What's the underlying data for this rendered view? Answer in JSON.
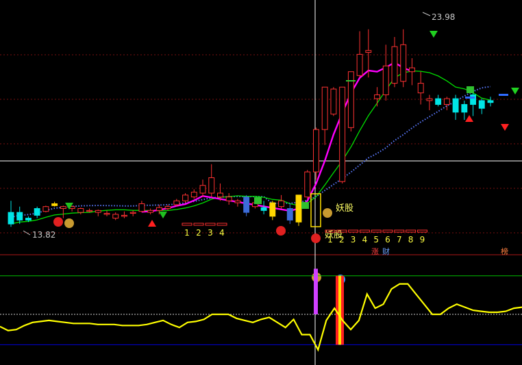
{
  "chart_data": [
    {
      "type": "candlestick",
      "title": "",
      "price_range": [
        12.8,
        25.2
      ],
      "price_labels": {
        "high": "23.98",
        "low": "13.82"
      },
      "candles": [
        {
          "o": 14.5,
          "h": 15.1,
          "l": 13.75,
          "c": 13.9,
          "color": "cyan"
        },
        {
          "o": 14.5,
          "h": 14.8,
          "l": 13.9,
          "c": 14.1,
          "color": "cyan"
        },
        {
          "o": 14.2,
          "h": 14.3,
          "l": 14.0,
          "c": 14.1,
          "color": "cyan"
        },
        {
          "o": 14.7,
          "h": 14.8,
          "l": 14.2,
          "c": 14.35,
          "color": "cyan"
        },
        {
          "o": 14.55,
          "h": 14.85,
          "l": 14.5,
          "c": 14.8,
          "color": "red"
        },
        {
          "o": 14.85,
          "h": 15.05,
          "l": 14.8,
          "c": 14.95,
          "color": "yellow"
        },
        {
          "o": 14.8,
          "h": 14.85,
          "l": 14.2,
          "c": 14.7,
          "color": "red"
        },
        {
          "o": 14.7,
          "h": 14.85,
          "l": 14.55,
          "c": 14.8,
          "color": "red"
        },
        {
          "o": 14.5,
          "h": 14.75,
          "l": 14.4,
          "c": 14.7,
          "color": "red"
        },
        {
          "o": 14.55,
          "h": 14.7,
          "l": 14.5,
          "c": 14.6,
          "color": "red"
        },
        {
          "o": 14.5,
          "h": 14.65,
          "l": 14.3,
          "c": 14.6,
          "color": "red"
        },
        {
          "o": 14.4,
          "h": 14.6,
          "l": 14.3,
          "c": 14.45,
          "color": "red"
        },
        {
          "o": 14.2,
          "h": 14.5,
          "l": 14.1,
          "c": 14.4,
          "color": "red"
        },
        {
          "o": 14.3,
          "h": 14.55,
          "l": 14.2,
          "c": 14.35,
          "color": "red"
        },
        {
          "o": 14.45,
          "h": 14.6,
          "l": 14.3,
          "c": 14.5,
          "color": "red"
        },
        {
          "o": 14.55,
          "h": 15.1,
          "l": 14.5,
          "c": 14.95,
          "color": "red"
        },
        {
          "o": 14.5,
          "h": 14.7,
          "l": 14.4,
          "c": 14.6,
          "color": "red"
        },
        {
          "o": 14.6,
          "h": 14.9,
          "l": 14.4,
          "c": 14.75,
          "color": "red"
        },
        {
          "o": 14.7,
          "h": 14.9,
          "l": 14.6,
          "c": 14.8,
          "color": "red"
        },
        {
          "o": 14.9,
          "h": 15.2,
          "l": 14.8,
          "c": 15.1,
          "color": "red"
        },
        {
          "o": 15.1,
          "h": 15.5,
          "l": 15.0,
          "c": 15.4,
          "color": "red"
        },
        {
          "o": 15.3,
          "h": 15.7,
          "l": 15.2,
          "c": 15.55,
          "color": "red"
        },
        {
          "o": 15.5,
          "h": 16.2,
          "l": 15.3,
          "c": 15.9,
          "color": "red"
        },
        {
          "o": 15.5,
          "h": 17.0,
          "l": 15.3,
          "c": 16.3,
          "color": "red"
        },
        {
          "o": 15.3,
          "h": 16.0,
          "l": 15.1,
          "c": 15.5,
          "color": "red"
        },
        {
          "o": 15.1,
          "h": 15.5,
          "l": 14.9,
          "c": 15.3,
          "color": "red"
        },
        {
          "o": 15.1,
          "h": 15.2,
          "l": 14.8,
          "c": 15.0,
          "color": "red"
        },
        {
          "o": 15.3,
          "h": 15.4,
          "l": 14.3,
          "c": 14.5,
          "color": "blue"
        },
        {
          "o": 15.0,
          "h": 15.1,
          "l": 14.7,
          "c": 14.8,
          "color": "red"
        },
        {
          "o": 14.75,
          "h": 15.1,
          "l": 14.4,
          "c": 14.6,
          "color": "cyan"
        },
        {
          "o": 15.0,
          "h": 15.1,
          "l": 14.1,
          "c": 14.3,
          "color": "yellow"
        },
        {
          "o": 14.8,
          "h": 15.4,
          "l": 14.7,
          "c": 15.1,
          "color": "red"
        },
        {
          "o": 14.7,
          "h": 15.0,
          "l": 13.9,
          "c": 14.1,
          "color": "blue"
        },
        {
          "o": 14.0,
          "h": 15.4,
          "l": 13.8,
          "c": 15.4,
          "color": "yellow"
        },
        {
          "o": 15.3,
          "h": 16.7,
          "l": 15.2,
          "c": 16.6,
          "color": "red"
        },
        {
          "o": 16.6,
          "h": 18.9,
          "l": 16.2,
          "c": 18.8,
          "color": "red"
        },
        {
          "o": 18.8,
          "h": 21.0,
          "l": 18.0,
          "c": 21.0,
          "color": "red"
        },
        {
          "o": 19.6,
          "h": 21.0,
          "l": 19.5,
          "c": 20.9,
          "color": "red"
        },
        {
          "o": 16.1,
          "h": 21.0,
          "l": 16.0,
          "c": 21.0,
          "color": "red"
        },
        {
          "o": 18.9,
          "h": 21.8,
          "l": 18.7,
          "c": 21.8,
          "color": "red"
        },
        {
          "o": 21.6,
          "h": 23.9,
          "l": 21.5,
          "c": 22.7,
          "color": "red"
        },
        {
          "o": 22.8,
          "h": 24.0,
          "l": 21.5,
          "c": 22.9,
          "color": "red"
        },
        {
          "o": 20.4,
          "h": 21.0,
          "l": 20.0,
          "c": 20.6,
          "color": "red"
        },
        {
          "o": 20.6,
          "h": 23.2,
          "l": 20.3,
          "c": 22.1,
          "color": "red"
        },
        {
          "o": 21.2,
          "h": 23.6,
          "l": 21.0,
          "c": 23.1,
          "color": "red"
        },
        {
          "o": 23.2,
          "h": 24.0,
          "l": 21.0,
          "c": 21.3,
          "color": "red"
        },
        {
          "o": 21.8,
          "h": 22.5,
          "l": 21.1,
          "c": 22.0,
          "color": "red"
        },
        {
          "o": 21.2,
          "h": 21.8,
          "l": 20.1,
          "c": 20.7,
          "color": "red"
        },
        {
          "o": 20.4,
          "h": 20.6,
          "l": 19.8,
          "c": 20.3,
          "color": "red"
        },
        {
          "o": 20.4,
          "h": 20.6,
          "l": 20.0,
          "c": 20.1,
          "color": "cyan"
        },
        {
          "o": 20.4,
          "h": 20.5,
          "l": 19.8,
          "c": 20.1,
          "color": "red"
        },
        {
          "o": 20.4,
          "h": 20.6,
          "l": 19.3,
          "c": 19.7,
          "color": "cyan"
        },
        {
          "o": 20.1,
          "h": 20.3,
          "l": 19.3,
          "c": 19.7,
          "color": "cyan"
        },
        {
          "o": 20.6,
          "h": 21.0,
          "l": 19.5,
          "c": 20.1,
          "color": "cyan"
        },
        {
          "o": 19.9,
          "h": 20.4,
          "l": 19.6,
          "c": 20.3,
          "color": "cyan"
        },
        {
          "o": 20.3,
          "h": 20.5,
          "l": 20.0,
          "c": 20.2,
          "color": "cyan"
        }
      ],
      "grid": true,
      "crosshair": true,
      "annotations": {
        "yaogu": "妖股",
        "zhang": "涨",
        "cai": "财",
        "bang": "榜",
        "kong": "空",
        "count_left": [
          "1",
          "2",
          "3",
          "4"
        ],
        "count_right": [
          "1",
          "2",
          "3",
          "4",
          "5",
          "6",
          "7",
          "8",
          "9"
        ]
      }
    },
    {
      "type": "line",
      "title": "",
      "ylim": [
        0,
        100
      ],
      "reference_levels": [
        88,
        50,
        20
      ],
      "series": [
        {
          "values": [
            38,
            34,
            35,
            39,
            42,
            43,
            44,
            43,
            42,
            41,
            41,
            41,
            40,
            40,
            40,
            39,
            39,
            39,
            40,
            42,
            44,
            40,
            37,
            42,
            43,
            45,
            50,
            50,
            50,
            46,
            44,
            42,
            45,
            47,
            42,
            37,
            45,
            30,
            30,
            15,
            44,
            56,
            44,
            35,
            44,
            70,
            56,
            60,
            75,
            80,
            80,
            70,
            60,
            50,
            50,
            56,
            60,
            57,
            54,
            53,
            52,
            52,
            53,
            56,
            57
          ]
        }
      ],
      "colors": {
        "main": "#ffff00",
        "upper": "#00c000",
        "mid": "#d8d8d8",
        "lower": "#0000d8"
      }
    }
  ],
  "colors": {
    "up": "#ff3232",
    "down_cyan": "#00e5e5",
    "down_blue": "#3b6bd8",
    "yellow": "#ffd700",
    "ma_fast": "#ff00ff",
    "ma_slow": "#00e000",
    "ma_dotted": "#5a7aff",
    "price_label": "#c8c8c8"
  }
}
